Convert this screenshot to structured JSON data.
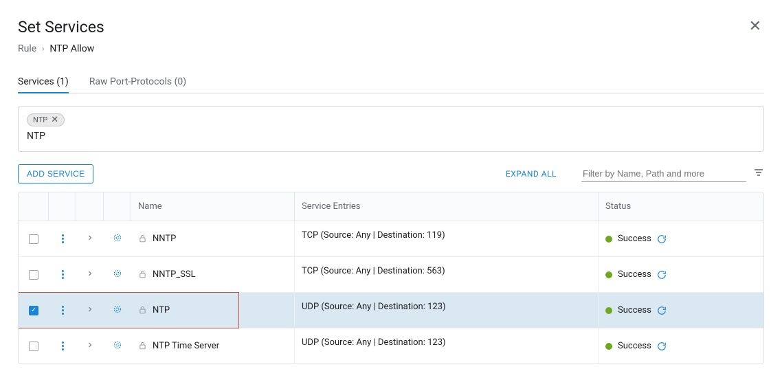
{
  "header": {
    "title": "Set Services"
  },
  "breadcrumb": {
    "root": "Rule",
    "current": "NTP Allow"
  },
  "tabs": {
    "services": {
      "label": "Services",
      "count": 1
    },
    "raw": {
      "label": "Raw Port-Protocols",
      "count": 0
    }
  },
  "filter_chip": {
    "label": "NTP"
  },
  "filter_text": "NTP",
  "toolbar": {
    "add_label": "ADD SERVICE",
    "expand_all": "EXPAND ALL",
    "filter_placeholder": "Filter by Name, Path and more"
  },
  "columns": {
    "name": "Name",
    "entries": "Service Entries",
    "status": "Status"
  },
  "rows": [
    {
      "checked": false,
      "name": "NNTP",
      "entries": "TCP (Source: Any | Destination: 119)",
      "status": "Success",
      "selected": false
    },
    {
      "checked": false,
      "name": "NNTP_SSL",
      "entries": "TCP (Source: Any | Destination: 563)",
      "status": "Success",
      "selected": false
    },
    {
      "checked": true,
      "name": "NTP",
      "entries": "UDP (Source: Any | Destination: 123)",
      "status": "Success",
      "selected": true
    },
    {
      "checked": false,
      "name": "NTP Time Server",
      "entries": "UDP (Source: Any | Destination: 123)",
      "status": "Success",
      "selected": false
    }
  ],
  "colors": {
    "accent": "#1784d6",
    "success": "#6fa81f",
    "highlight": "#d54d3f"
  }
}
